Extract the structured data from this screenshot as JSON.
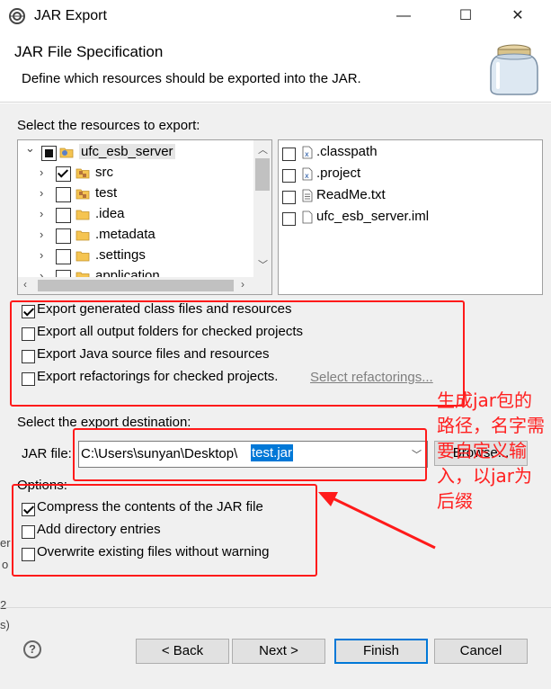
{
  "window": {
    "title": "JAR Export",
    "minimize_glyph": "—",
    "maximize_glyph": "☐",
    "close_glyph": "✕"
  },
  "header": {
    "title": "JAR File Specification",
    "description": "Define which resources should be exported into the JAR."
  },
  "resources": {
    "label": "Select the resources to export:",
    "tree": [
      {
        "name": "ufc_esb_server",
        "state": "partial",
        "icon": "project-icon",
        "expanded": true
      },
      {
        "name": "src",
        "state": "checked",
        "icon": "package-folder-icon"
      },
      {
        "name": "test",
        "state": "unchecked",
        "icon": "package-folder-icon"
      },
      {
        "name": ".idea",
        "state": "unchecked",
        "icon": "folder-icon"
      },
      {
        "name": ".metadata",
        "state": "unchecked",
        "icon": "folder-icon"
      },
      {
        "name": ".settings",
        "state": "unchecked",
        "icon": "folder-icon"
      },
      {
        "name": "application",
        "state": "unchecked",
        "icon": "folder-icon"
      }
    ],
    "files": [
      {
        "name": ".classpath",
        "icon": "x-file-icon"
      },
      {
        "name": ".project",
        "icon": "x-file-icon"
      },
      {
        "name": "ReadMe.txt",
        "icon": "text-file-icon"
      },
      {
        "name": "ufc_esb_server.iml",
        "icon": "file-icon"
      }
    ]
  },
  "export_options": [
    {
      "label": "Export generated class files and resources",
      "checked": true
    },
    {
      "label": "Export all output folders for checked projects",
      "checked": false
    },
    {
      "label": "Export Java source files and resources",
      "checked": false
    },
    {
      "label": "Export refactorings for checked projects.",
      "checked": false
    }
  ],
  "select_refactorings_link": "Select refactorings...",
  "destination": {
    "label": "Select the export destination:",
    "jar_label": "JAR file:",
    "path_prefix": "C:\\Users\\sunyan\\Desktop\\",
    "path_selected": "test.jar",
    "browse_label": "Browse..."
  },
  "options": {
    "label": "Options:",
    "items": [
      {
        "label": "Compress the contents of the JAR file",
        "checked": true
      },
      {
        "label": "Add directory entries",
        "checked": false
      },
      {
        "label": "Overwrite existing files without warning",
        "checked": false
      }
    ]
  },
  "buttons": {
    "help": "?",
    "back": "< Back",
    "next": "Next >",
    "finish": "Finish",
    "cancel": "Cancel"
  },
  "annotation": {
    "text": "生成jar包的路径，名字需要自定义输入，以jar为后缀",
    "color": "#ff2020"
  },
  "background_fragments": [
    "er",
    "o",
    "2",
    "s)"
  ],
  "colors": {
    "accent": "#0078d7",
    "selection": "#0078d7",
    "annotation_red": "#ff1a1a"
  }
}
